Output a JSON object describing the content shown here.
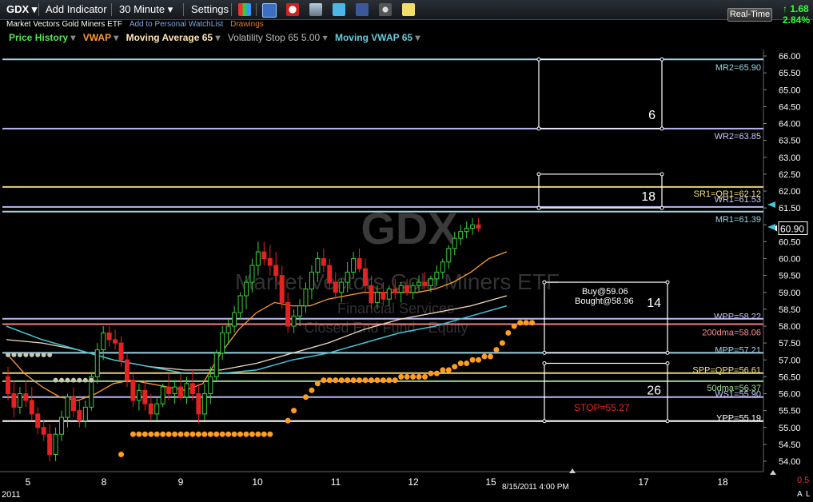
{
  "toolbar": {
    "symbol": "GDX",
    "add_indicator": "Add Indicator",
    "interval": "30 Minute",
    "settings": "Settings",
    "realtime": "Real-Time",
    "change": "↑ 1.68",
    "change_pct": "2.84%"
  },
  "header": {
    "name": "Market Vectors Gold Miners ETF",
    "watchlist": "Add to Personal WatchList",
    "drawings": "Drawings"
  },
  "indicators": [
    {
      "label": "Price History",
      "color": "#5de35d"
    },
    {
      "label": "VWAP",
      "color": "#ff9933"
    },
    {
      "label": "Moving Average 65",
      "color": "#ffe6b3"
    },
    {
      "label": "Volatility Stop 65 5.00",
      "color": "#bbbbbb"
    },
    {
      "label": "Moving VWAP 65",
      "color": "#66ccdd"
    }
  ],
  "watermark": {
    "symbol": "GDX",
    "name": "Market Vectors Gold Miners ETF",
    "sector": "Financial Services",
    "type": "Closed End Fund - Equity"
  },
  "chart_data": {
    "type": "candlestick",
    "ylim": [
      53.7,
      66.2
    ],
    "y_ticks": [
      "66.00",
      "65.50",
      "65.00",
      "64.50",
      "64.00",
      "63.50",
      "63.00",
      "62.50",
      "62.00",
      "61.50",
      "61.00",
      "60.50",
      "60.00",
      "59.50",
      "59.00",
      "58.50",
      "58.00",
      "57.50",
      "57.00",
      "56.50",
      "56.00",
      "55.50",
      "55.00",
      "54.50",
      "54.00"
    ],
    "x_labels": [
      "5",
      "8",
      "9",
      "10",
      "11",
      "12",
      "15",
      "17",
      "18"
    ],
    "x_label_index": [
      0,
      13,
      26,
      39,
      52,
      65,
      78,
      104,
      117
    ],
    "year_label": "2011",
    "timestamp": "8/15/2011 4:00 PM",
    "last_price": "60.90",
    "corner_value": "0.5",
    "candles": [
      [
        56.5,
        56.8,
        55.8,
        56.0
      ],
      [
        56.0,
        56.4,
        55.3,
        55.6
      ],
      [
        55.6,
        56.2,
        55.4,
        56.0
      ],
      [
        56.0,
        56.4,
        55.6,
        55.8
      ],
      [
        55.8,
        56.2,
        55.2,
        55.4
      ],
      [
        55.4,
        55.6,
        54.8,
        55.0
      ],
      [
        55.0,
        55.2,
        54.6,
        54.8
      ],
      [
        54.8,
        55.1,
        54.0,
        54.2
      ],
      [
        54.2,
        55.0,
        54.0,
        54.8
      ],
      [
        54.8,
        55.5,
        54.6,
        55.3
      ],
      [
        55.3,
        56.0,
        55.0,
        55.9
      ],
      [
        55.9,
        56.2,
        55.3,
        55.5
      ],
      [
        55.5,
        55.8,
        55.0,
        55.2
      ],
      [
        55.2,
        55.8,
        55.0,
        55.6
      ],
      [
        55.6,
        56.6,
        55.5,
        56.5
      ],
      [
        56.5,
        57.5,
        56.3,
        57.3
      ],
      [
        57.3,
        58.0,
        57.0,
        57.8
      ],
      [
        57.8,
        58.0,
        57.4,
        57.6
      ],
      [
        57.6,
        57.9,
        57.3,
        57.5
      ],
      [
        57.5,
        57.7,
        56.8,
        57.0
      ],
      [
        57.0,
        57.2,
        56.2,
        56.4
      ],
      [
        56.4,
        56.6,
        55.6,
        55.8
      ],
      [
        55.8,
        56.3,
        55.5,
        56.1
      ],
      [
        56.1,
        56.4,
        55.5,
        55.7
      ],
      [
        55.7,
        56.0,
        55.2,
        55.4
      ],
      [
        55.4,
        55.9,
        55.2,
        55.7
      ],
      [
        55.7,
        56.3,
        55.6,
        56.2
      ],
      [
        56.2,
        56.6,
        55.8,
        56.0
      ],
      [
        56.0,
        56.4,
        55.7,
        56.2
      ],
      [
        56.2,
        56.6,
        55.8,
        55.9
      ],
      [
        55.9,
        56.5,
        55.7,
        56.3
      ],
      [
        56.3,
        56.7,
        55.8,
        56.0
      ],
      [
        56.0,
        56.3,
        55.1,
        55.4
      ],
      [
        55.4,
        56.3,
        55.2,
        56.0
      ],
      [
        56.0,
        56.8,
        55.7,
        56.5
      ],
      [
        56.5,
        57.3,
        56.4,
        57.2
      ],
      [
        57.2,
        58.0,
        57.0,
        57.8
      ],
      [
        57.8,
        58.2,
        57.5,
        58.0
      ],
      [
        58.0,
        58.6,
        57.8,
        58.4
      ],
      [
        58.4,
        59.0,
        58.2,
        58.9
      ],
      [
        58.9,
        59.5,
        58.5,
        59.3
      ],
      [
        59.3,
        60.0,
        59.0,
        59.8
      ],
      [
        59.8,
        60.5,
        59.5,
        60.2
      ],
      [
        60.2,
        60.5,
        59.8,
        60.0
      ],
      [
        60.0,
        60.4,
        59.5,
        59.8
      ],
      [
        59.8,
        60.2,
        59.3,
        59.5
      ],
      [
        59.5,
        59.8,
        58.5,
        58.7
      ],
      [
        58.7,
        59.0,
        57.8,
        58.0
      ],
      [
        58.0,
        58.5,
        57.8,
        58.3
      ],
      [
        58.3,
        58.8,
        58.0,
        58.6
      ],
      [
        58.6,
        59.3,
        58.4,
        59.1
      ],
      [
        59.1,
        59.8,
        58.8,
        59.6
      ],
      [
        59.6,
        60.2,
        59.3,
        60.0
      ],
      [
        60.0,
        60.3,
        59.6,
        59.8
      ],
      [
        59.8,
        60.0,
        59.1,
        59.3
      ],
      [
        59.3,
        59.6,
        58.8,
        59.0
      ],
      [
        59.0,
        59.4,
        58.7,
        59.3
      ],
      [
        59.3,
        59.9,
        59.0,
        59.6
      ],
      [
        59.6,
        60.2,
        59.4,
        60.0
      ],
      [
        60.0,
        60.3,
        59.6,
        59.7
      ],
      [
        59.7,
        60.0,
        59.0,
        59.2
      ],
      [
        59.2,
        59.5,
        58.5,
        58.7
      ],
      [
        58.7,
        59.2,
        58.5,
        59.0
      ],
      [
        59.0,
        59.3,
        58.6,
        58.8
      ],
      [
        58.8,
        59.2,
        58.6,
        59.1
      ],
      [
        59.1,
        59.4,
        58.8,
        59.0
      ],
      [
        59.0,
        59.3,
        58.7,
        59.2
      ],
      [
        59.2,
        59.4,
        58.9,
        59.0
      ],
      [
        59.0,
        59.3,
        58.8,
        59.2
      ],
      [
        59.2,
        59.5,
        59.0,
        59.3
      ],
      [
        59.3,
        59.6,
        59.1,
        59.2
      ],
      [
        59.2,
        59.5,
        59.0,
        59.4
      ],
      [
        59.4,
        59.8,
        59.2,
        59.6
      ],
      [
        59.6,
        60.0,
        59.4,
        59.9
      ],
      [
        59.9,
        60.4,
        59.7,
        60.3
      ],
      [
        60.3,
        60.8,
        60.1,
        60.6
      ],
      [
        60.6,
        61.0,
        60.4,
        60.8
      ],
      [
        60.8,
        61.1,
        60.6,
        60.9
      ],
      [
        60.9,
        61.2,
        60.7,
        61.0
      ],
      [
        61.0,
        61.2,
        60.8,
        60.9
      ]
    ],
    "x_offset": 0,
    "vwap": [
      [
        0,
        57.2
      ],
      [
        3,
        56.6
      ],
      [
        6,
        56.2
      ],
      [
        9,
        55.9
      ],
      [
        12,
        55.8
      ],
      [
        15,
        56.0
      ],
      [
        18,
        56.3
      ],
      [
        21,
        56.4
      ],
      [
        24,
        56.3
      ],
      [
        27,
        56.2
      ],
      [
        30,
        56.1
      ],
      [
        33,
        56.3
      ],
      [
        36,
        57.2
      ],
      [
        39,
        57.9
      ],
      [
        42,
        58.4
      ],
      [
        45,
        58.7
      ],
      [
        48,
        58.6
      ],
      [
        51,
        58.6
      ],
      [
        54,
        58.8
      ],
      [
        57,
        58.9
      ],
      [
        60,
        59.0
      ],
      [
        63,
        59.0
      ],
      [
        66,
        59.0
      ],
      [
        69,
        59.0
      ],
      [
        72,
        59.1
      ],
      [
        75,
        59.3
      ],
      [
        78,
        59.6
      ],
      [
        81,
        60.0
      ],
      [
        84,
        60.2
      ]
    ],
    "ma65": [
      [
        0,
        57.6
      ],
      [
        6,
        57.5
      ],
      [
        12,
        57.3
      ],
      [
        18,
        57.0
      ],
      [
        24,
        56.8
      ],
      [
        30,
        56.7
      ],
      [
        36,
        56.7
      ],
      [
        42,
        56.9
      ],
      [
        48,
        57.2
      ],
      [
        54,
        57.5
      ],
      [
        60,
        57.9
      ],
      [
        66,
        58.2
      ],
      [
        72,
        58.4
      ],
      [
        78,
        58.6
      ],
      [
        84,
        58.9
      ]
    ],
    "mvwap65": [
      [
        0,
        58.0
      ],
      [
        6,
        57.6
      ],
      [
        12,
        57.3
      ],
      [
        18,
        57.0
      ],
      [
        24,
        56.8
      ],
      [
        30,
        56.6
      ],
      [
        36,
        56.6
      ],
      [
        42,
        56.7
      ],
      [
        48,
        57.0
      ],
      [
        54,
        57.2
      ],
      [
        60,
        57.5
      ],
      [
        66,
        57.8
      ],
      [
        72,
        58.0
      ],
      [
        78,
        58.3
      ],
      [
        84,
        58.6
      ]
    ],
    "gray_dots": {
      "start": 0,
      "end": 7,
      "value": 57.15
    },
    "gray_dots2": {
      "start": 8,
      "end": 14,
      "value": 56.4
    },
    "orange_dots": [
      [
        19,
        54.2
      ],
      [
        21,
        54.8
      ],
      [
        22,
        54.8
      ],
      [
        23,
        54.8
      ],
      [
        24,
        54.8
      ],
      [
        25,
        54.8
      ],
      [
        26,
        54.8
      ],
      [
        27,
        54.8
      ],
      [
        28,
        54.8
      ],
      [
        29,
        54.8
      ],
      [
        30,
        54.8
      ],
      [
        31,
        54.8
      ],
      [
        32,
        54.8
      ],
      [
        33,
        54.8
      ],
      [
        34,
        54.8
      ],
      [
        35,
        54.8
      ],
      [
        36,
        54.8
      ],
      [
        37,
        54.8
      ],
      [
        38,
        54.8
      ],
      [
        39,
        54.8
      ],
      [
        40,
        54.8
      ],
      [
        41,
        54.8
      ],
      [
        42,
        54.8
      ],
      [
        43,
        54.8
      ],
      [
        44,
        54.8
      ],
      [
        47,
        55.2
      ],
      [
        48,
        55.5
      ],
      [
        50,
        55.9
      ],
      [
        51,
        56.1
      ],
      [
        52,
        56.3
      ],
      [
        53,
        56.4
      ],
      [
        54,
        56.4
      ],
      [
        55,
        56.4
      ],
      [
        56,
        56.4
      ],
      [
        57,
        56.4
      ],
      [
        58,
        56.4
      ],
      [
        59,
        56.4
      ],
      [
        60,
        56.4
      ],
      [
        61,
        56.4
      ],
      [
        62,
        56.4
      ],
      [
        63,
        56.4
      ],
      [
        64,
        56.4
      ],
      [
        65,
        56.4
      ],
      [
        66,
        56.5
      ],
      [
        67,
        56.5
      ],
      [
        68,
        56.5
      ],
      [
        69,
        56.5
      ],
      [
        70,
        56.5
      ],
      [
        71,
        56.6
      ],
      [
        72,
        56.6
      ],
      [
        73,
        56.7
      ],
      [
        74,
        56.7
      ],
      [
        75,
        56.8
      ],
      [
        76,
        56.9
      ],
      [
        77,
        56.9
      ],
      [
        78,
        57.0
      ],
      [
        79,
        57.0
      ],
      [
        80,
        57.1
      ],
      [
        81,
        57.1
      ],
      [
        82,
        57.3
      ],
      [
        83,
        57.5
      ],
      [
        84,
        57.8
      ],
      [
        85,
        58.0
      ],
      [
        86,
        58.1
      ],
      [
        87,
        58.1
      ],
      [
        88,
        58.1
      ]
    ],
    "levels": [
      {
        "label": "MR2=65.90",
        "value": 65.9,
        "color": "#9ad3e6",
        "text_color": "#9ad3e6"
      },
      {
        "label": "WR2=63.85",
        "value": 63.85,
        "color": "#b8b8f0",
        "text_color": "#c8c8ff"
      },
      {
        "label": "SR1=QR1=62.12",
        "value": 62.12,
        "color": "#e8d070",
        "text_color": "#f3e27a"
      },
      {
        "label": "WR1=61.53",
        "value": 61.53,
        "color": "#b8b8f0",
        "text_color": "#c8c8ff"
      },
      {
        "label": "MR1=61.39",
        "value": 61.39,
        "color": "#9ad3e6",
        "text_color": "#9ad3e6"
      },
      {
        "label": "WPP=58.22",
        "value": 58.22,
        "color": "#b8b8f0",
        "text_color": "#c8c8ff"
      },
      {
        "label": "200dma=58.06",
        "value": 58.06,
        "color": "#f08080",
        "text_color": "#ff8c8c"
      },
      {
        "label": "MPP=57.21",
        "value": 57.21,
        "color": "#9ad3e6",
        "text_color": "#9ad3e6"
      },
      {
        "label": "SPP=QPP=56.61",
        "value": 56.61,
        "color": "#e8d070",
        "text_color": "#f3e27a"
      },
      {
        "label": "50dma=56.37",
        "value": 56.37,
        "color": "#90d090",
        "text_color": "#a0e0a0"
      },
      {
        "label": "WS1=55.90",
        "value": 55.9,
        "color": "#b8b8f0",
        "text_color": "#c8c8ff"
      },
      {
        "label": "YPP=55.19",
        "value": 55.19,
        "color": "#ffffff",
        "text_color": "#ffffff"
      }
    ],
    "boxes": [
      {
        "label": "6",
        "top": 65.9,
        "bottom": 63.85
      },
      {
        "label": "18",
        "top": 62.5,
        "bottom": 61.5
      },
      {
        "label": "14",
        "top": 59.3,
        "bottom": 57.21
      },
      {
        "label": "26",
        "top": 56.9,
        "bottom": 55.19
      }
    ],
    "buy_note": "Buy@59.06",
    "bought_note": "Bought@58.96",
    "stop_note": "STOP=55.27"
  }
}
